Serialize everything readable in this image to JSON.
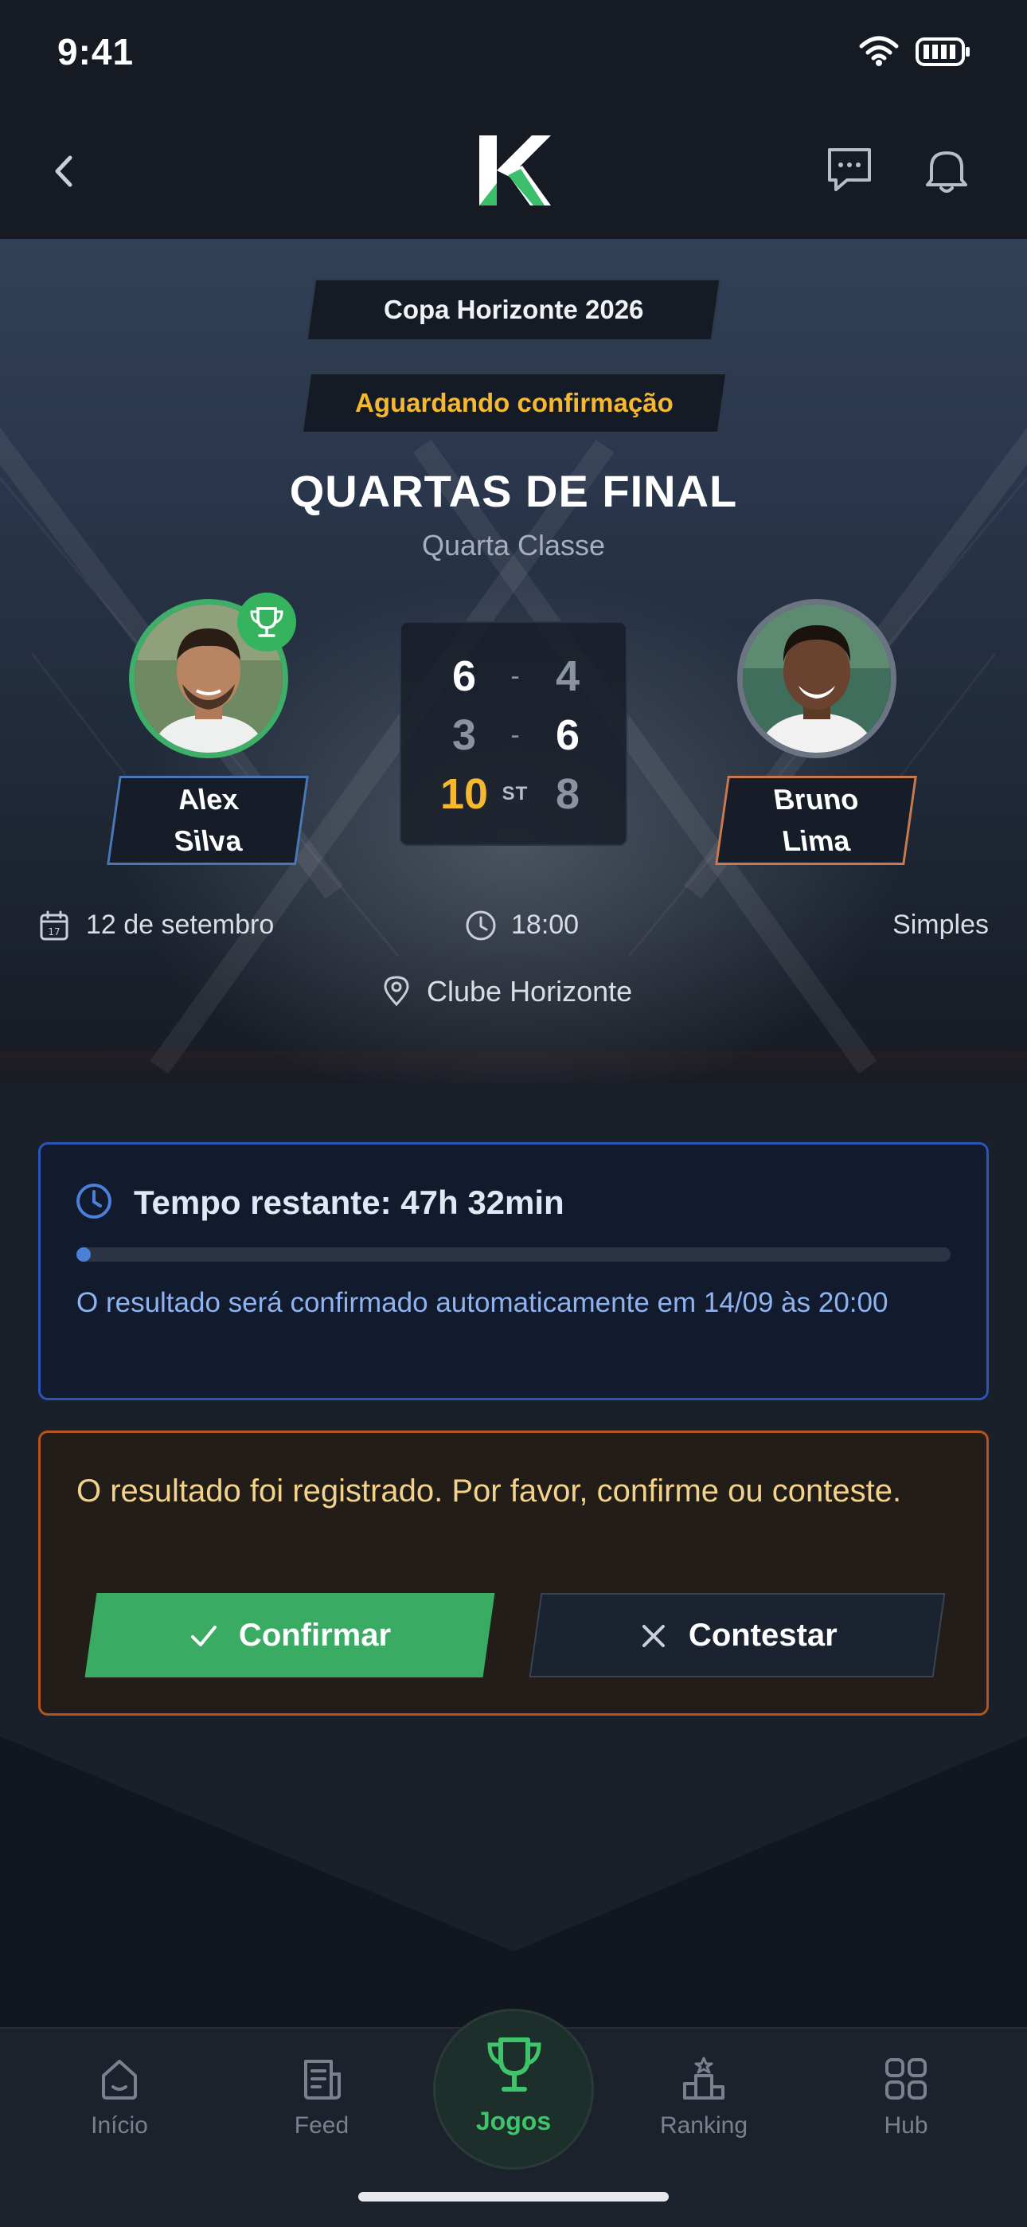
{
  "status_bar": {
    "time": "9:41"
  },
  "header": {
    "back_icon": "chevron-left-icon",
    "logo": "K",
    "chat_icon": "chat-bubble-icon",
    "bell_icon": "bell-icon"
  },
  "match": {
    "tournament": "Copa Horizonte 2026",
    "status": "Aguardando confirmação",
    "round": "QUARTAS DE FINAL",
    "category": "Quarta Classe",
    "player_left": {
      "first": "Alex",
      "last": "Silva",
      "winner": true
    },
    "player_right": {
      "first": "Bruno",
      "last": "Lima",
      "winner": false
    },
    "sets": [
      {
        "a": "6",
        "sep": "-",
        "b": "4"
      },
      {
        "a": "3",
        "sep": "-",
        "b": "6"
      },
      {
        "a": "10",
        "sep": "ST",
        "b": "8"
      }
    ],
    "date": "12 de setembro",
    "time": "18:00",
    "type": "Simples",
    "location": "Clube Horizonte"
  },
  "timer": {
    "title": "Tempo restante: 47h 32min",
    "progress": 0.01,
    "description": "O resultado será confirmado automaticamente em 14/09 às 20:00"
  },
  "confirmation": {
    "message": "O resultado foi registrado. Por favor, confirme ou conteste.",
    "confirm_label": "Confirmar",
    "contest_label": "Contestar"
  },
  "nav": {
    "items": [
      {
        "label": "Início",
        "icon": "home-icon"
      },
      {
        "label": "Feed",
        "icon": "news-icon"
      },
      {
        "label": "Jogos",
        "icon": "trophy-icon"
      },
      {
        "label": "Ranking",
        "icon": "podium-icon"
      },
      {
        "label": "Hub",
        "icon": "grid-icon"
      }
    ],
    "active": "Jogos"
  },
  "colors": {
    "accent_green": "#3aab63",
    "warning_yellow": "#f5b82e",
    "info_blue": "#2b54b8",
    "alert_orange": "#b5541e"
  }
}
